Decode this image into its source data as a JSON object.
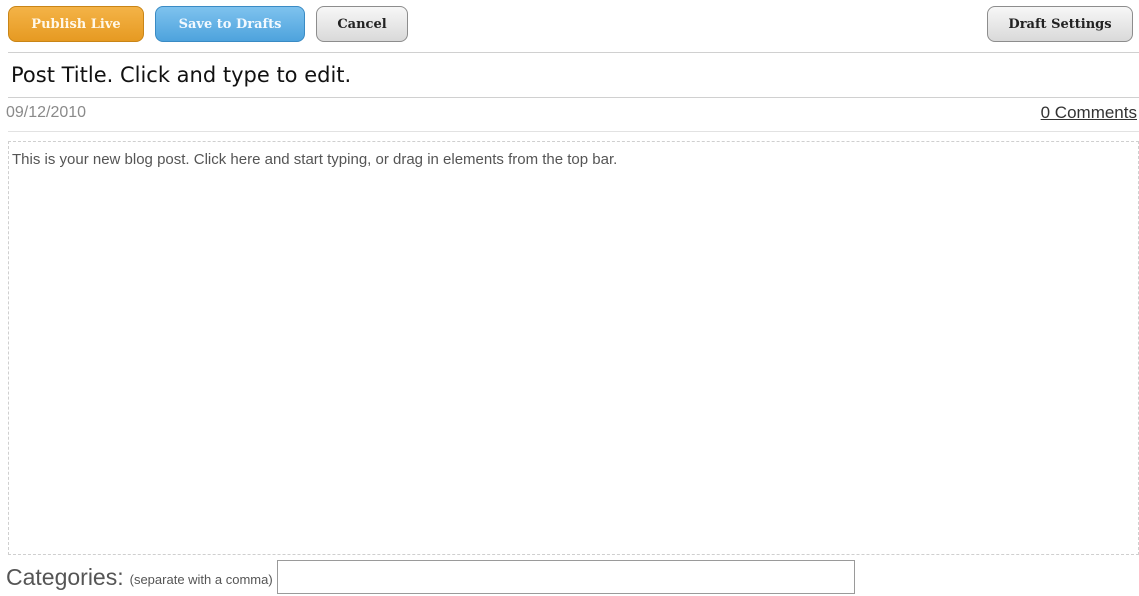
{
  "toolbar": {
    "publish_label": "Publish Live",
    "drafts_label": "Save to Drafts",
    "cancel_label": "Cancel",
    "settings_label": "Draft Settings"
  },
  "post": {
    "title": "Post Title. Click and type to edit.",
    "date": "09/12/2010",
    "comments_label": "0 Comments",
    "body": "This is your new blog post. Click here and start typing, or drag in elements from the top bar."
  },
  "categories": {
    "label": "Categories:",
    "hint": "(separate with a comma)",
    "value": ""
  },
  "colors": {
    "publish": "#e69a22",
    "drafts": "#4ea3dd",
    "neutral": "#d9d9d9"
  }
}
